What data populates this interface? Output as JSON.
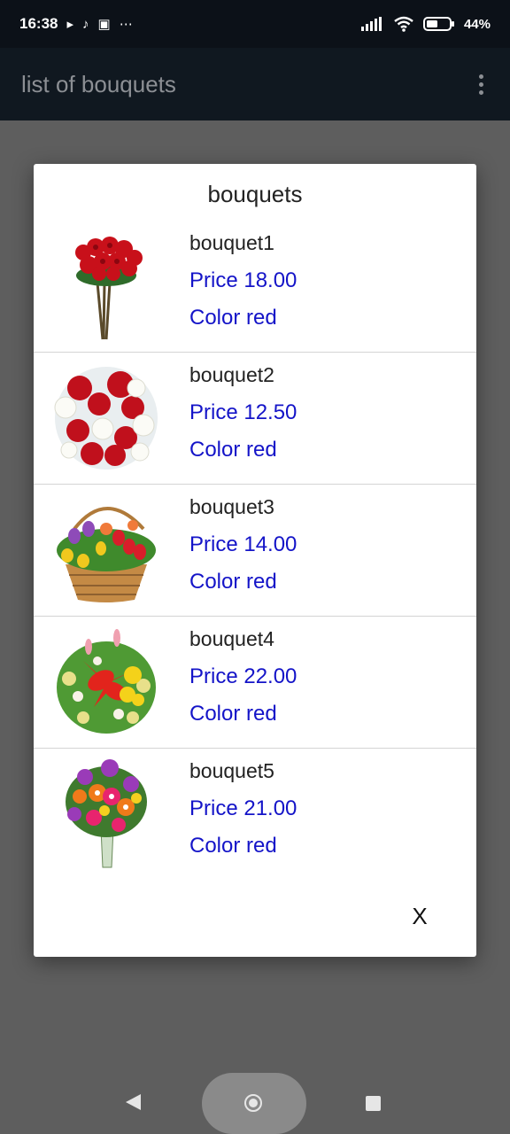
{
  "status_bar": {
    "time": "16:38",
    "left_icons": [
      "play-icon",
      "tiktok-icon",
      "gb-badge-icon",
      "more-dots-icon"
    ],
    "battery": "44%"
  },
  "app_bar": {
    "title": "list of bouquets"
  },
  "dialog": {
    "title": "bouquets",
    "items": [
      {
        "name": "bouquet1",
        "price": "Price 18.00",
        "color": "Color red",
        "image": "red-rose-bouquet"
      },
      {
        "name": "bouquet2",
        "price": "Price 12.50",
        "color": "Color red",
        "image": "red-white-rose-bouquet"
      },
      {
        "name": "bouquet3",
        "price": "Price 14.00",
        "color": "Color red",
        "image": "tulip-basket"
      },
      {
        "name": "bouquet4",
        "price": "Price 22.00",
        "color": "Color red",
        "image": "lily-bouquet"
      },
      {
        "name": "bouquet5",
        "price": "Price 21.00",
        "color": "Color red",
        "image": "mixed-gerbera-bouquet"
      }
    ],
    "close_label": "X"
  },
  "colors": {
    "price_text": "#1414c8",
    "status_bar": "#0c1118",
    "app_bar": "#101820",
    "scrim": "#5e5e5e"
  }
}
